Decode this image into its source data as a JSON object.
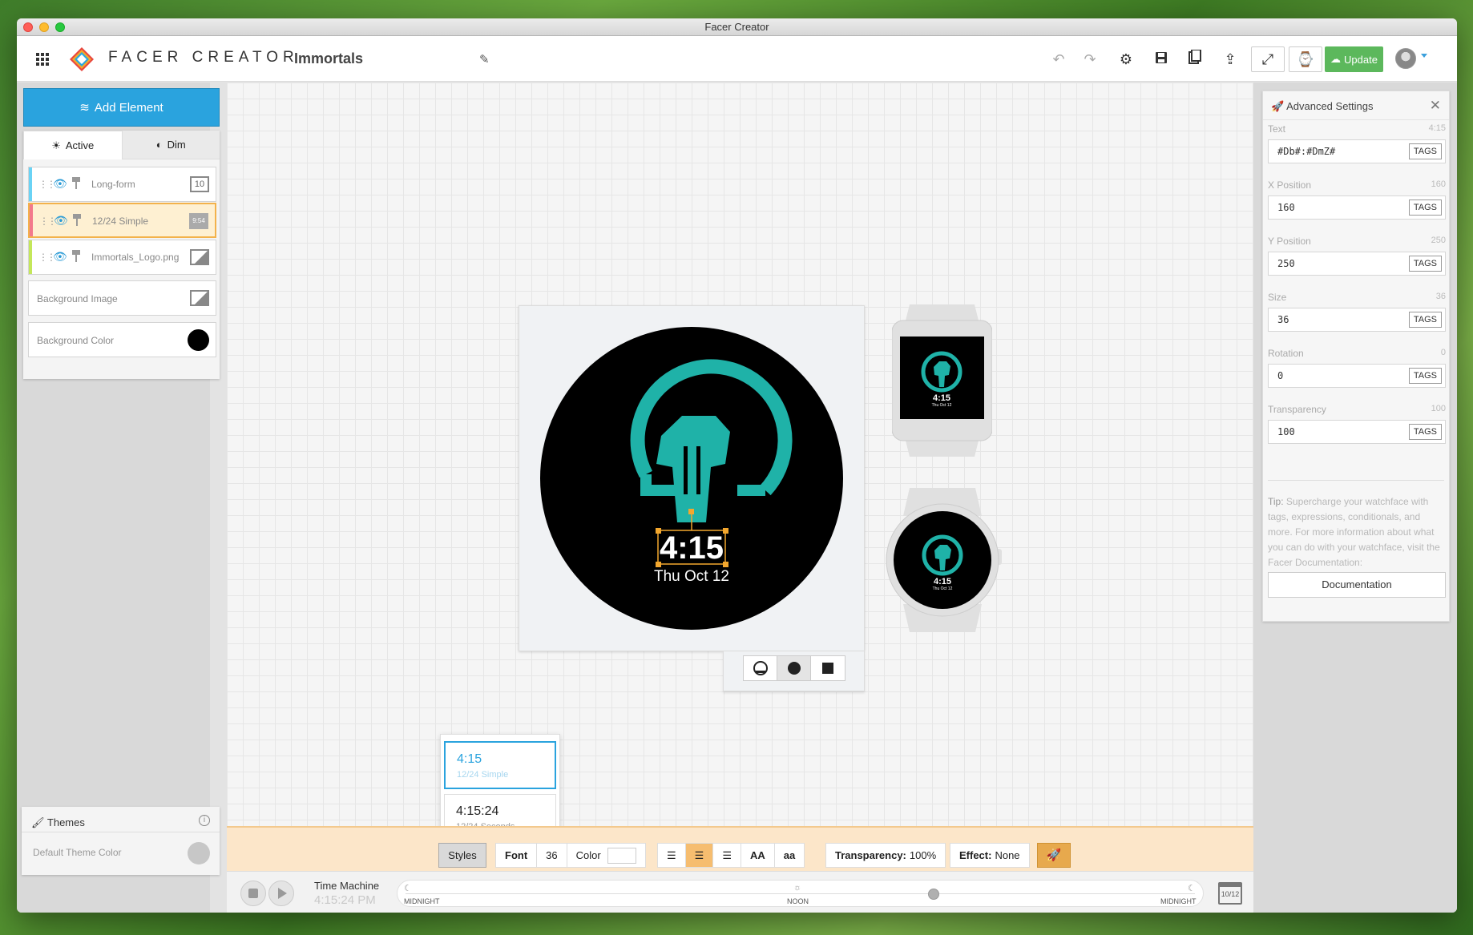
{
  "window": {
    "title": "Facer Creator"
  },
  "header": {
    "brand": "FACER CREATOR",
    "project_name": "Immortals",
    "update_label": "Update"
  },
  "sidebar": {
    "add_element_label": "Add Element",
    "tabs": [
      {
        "label": "Active",
        "icon": "sun-icon"
      },
      {
        "label": "Dim",
        "icon": "half-circle-icon"
      }
    ],
    "layers": [
      {
        "name": "Long-form",
        "color": "#6ad3f5",
        "thumb": "10"
      },
      {
        "name": "12/24 Simple",
        "color": "#f3798c",
        "thumb": "9:54",
        "selected": true
      },
      {
        "name": "Immortals_Logo.png",
        "color": "#c4e75a",
        "thumb": ""
      }
    ],
    "background_image_label": "Background Image",
    "background_color_label": "Background Color",
    "background_color": "#000000",
    "themes_label": "Themes",
    "default_theme_color_label": "Default Theme Color"
  },
  "watchface": {
    "time": "4:15",
    "date": "Thu Oct 12",
    "accent": "#1fb2a8"
  },
  "time_format_popover": [
    {
      "value": "4:15",
      "label": "12/24 Simple",
      "selected": true
    },
    {
      "value": "4:15:24",
      "label": "12/24 Seconds",
      "selected": false
    }
  ],
  "format_bar": {
    "styles_label": "Styles",
    "font_label": "Font",
    "font_size": "36",
    "color_label": "Color",
    "upper_label": "AA",
    "lower_label": "aa",
    "transparency_label": "Transparency:",
    "transparency_value": "100%",
    "effect_label": "Effect:",
    "effect_value": "None"
  },
  "time_machine": {
    "label": "Time Machine",
    "time": "4:15:24 PM",
    "marks": [
      "MIDNIGHT",
      "NOON",
      "MIDNIGHT"
    ],
    "calendar": "10/12",
    "position_fraction": 0.67
  },
  "advanced": {
    "title": "Advanced Settings",
    "fields": [
      {
        "label": "Text",
        "current": "4:15",
        "value": "#Db#:#DmZ#"
      },
      {
        "label": "X Position",
        "current": "160",
        "value": "160"
      },
      {
        "label": "Y Position",
        "current": "250",
        "value": "250"
      },
      {
        "label": "Size",
        "current": "36",
        "value": "36"
      },
      {
        "label": "Rotation",
        "current": "0",
        "value": "0"
      },
      {
        "label": "Transparency",
        "current": "100",
        "value": "100"
      }
    ],
    "tags_label": "TAGS",
    "tip_label": "Tip:",
    "tip_text": "Supercharge your watchface with tags, expressions, conditionals, and more. For more information about what you can do with your watchface, visit the Facer Documentation:",
    "documentation_label": "Documentation"
  }
}
